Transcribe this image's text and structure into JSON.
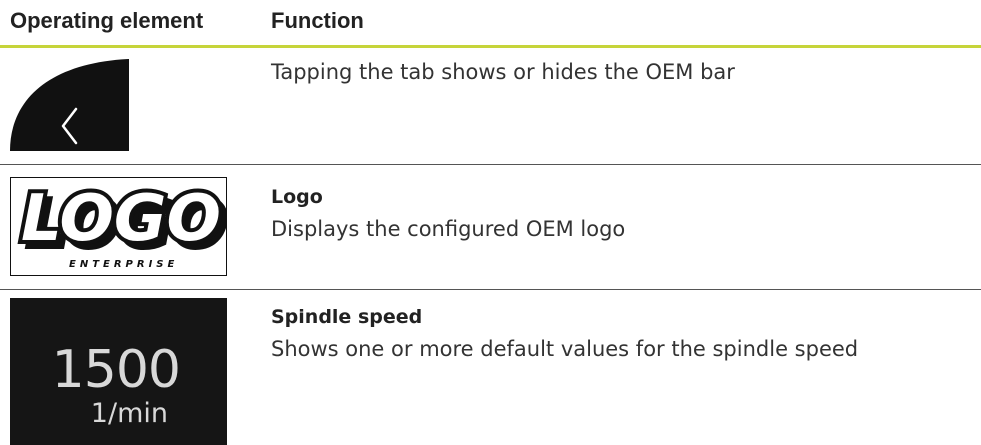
{
  "table": {
    "headers": {
      "operating_element": "Operating element",
      "function": "Function"
    },
    "rows": [
      {
        "element_icon": "oem-bar-tab-chevron-left-icon",
        "title": "",
        "description": "Tapping the tab shows or hides the OEM bar"
      },
      {
        "element_icon": "oem-logo-icon",
        "logo_text": "LOGO",
        "logo_subtext": "ENTERPRISE",
        "title": "Logo",
        "description": "Displays the configured OEM logo"
      },
      {
        "element_icon": "spindle-speed-display",
        "spindle_value": "1500",
        "spindle_unit": "1/min",
        "title": "Spindle speed",
        "description": "Shows one or more default values for the spindle speed"
      }
    ]
  },
  "colors": {
    "header_rule": "#c6d43a",
    "row_rule": "#555555",
    "icon_dark": "#111111",
    "spindle_bg": "#151515",
    "spindle_text": "#d8d8d8"
  }
}
